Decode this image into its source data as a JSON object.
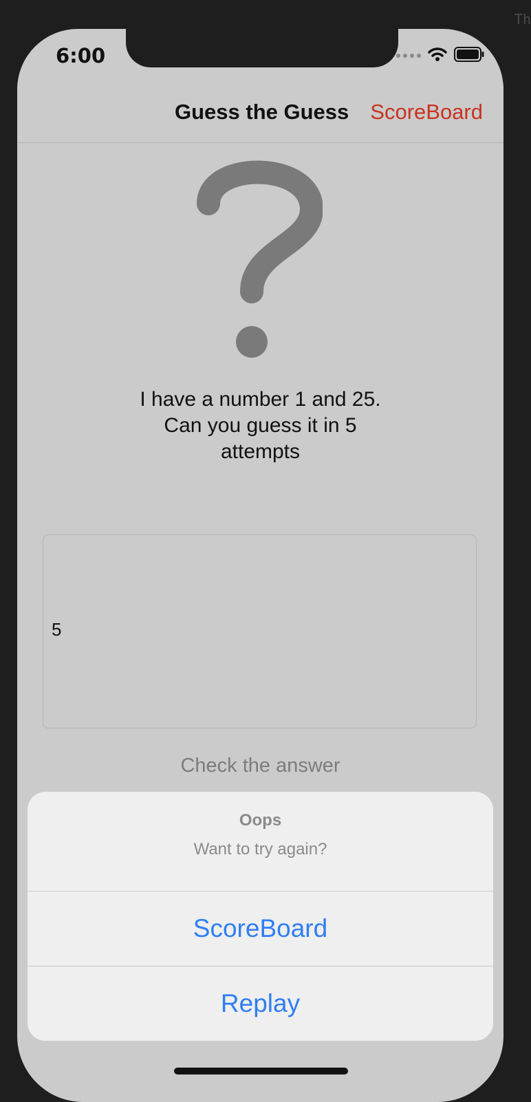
{
  "corner_text": "Th",
  "status_bar": {
    "time": "6:00"
  },
  "nav": {
    "title": "Guess the Guess",
    "scoreboard_label": "ScoreBoard",
    "accent_color": "#c8331f"
  },
  "main": {
    "icon": "question-mark-icon",
    "prompt_lines": [
      "I have a number 1 and 25.",
      "Can you guess it in 5",
      "attempts"
    ],
    "guess_value": "5",
    "check_label": "Check the answer"
  },
  "action_sheet": {
    "title": "Oops",
    "message": "Want to try again?",
    "actions": [
      {
        "label": "ScoreBoard"
      },
      {
        "label": "Replay"
      }
    ],
    "action_color": "#2f7ef2"
  }
}
